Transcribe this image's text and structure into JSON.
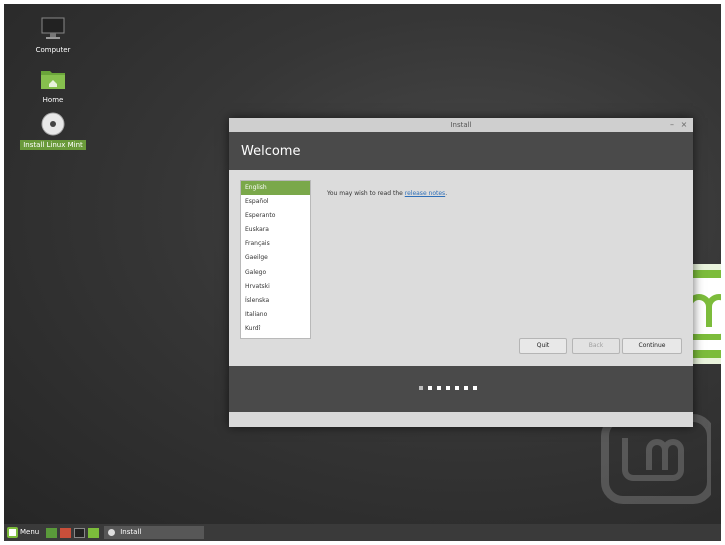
{
  "desktop": {
    "icons": [
      {
        "label": "Computer",
        "icon": "monitor-icon"
      },
      {
        "label": "Home",
        "icon": "folder-icon"
      },
      {
        "label": "Install Linux Mint",
        "icon": "disc-icon"
      }
    ]
  },
  "window": {
    "title": "Install",
    "minimize": "–",
    "close": "×",
    "heading": "Welcome",
    "languages": [
      "English",
      "Español",
      "Esperanto",
      "Euskara",
      "Français",
      "Gaeilge",
      "Galego",
      "Hrvatski",
      "Íslenska",
      "Italiano",
      "Kurdî"
    ],
    "selected_language": "English",
    "release_prefix": "You may wish to read the ",
    "release_link": "release notes",
    "release_suffix": ".",
    "buttons": {
      "quit": "Quit",
      "back": "Back",
      "continue": "Continue"
    },
    "progress": {
      "total_steps": 7,
      "current_step": 1
    }
  },
  "taskbar": {
    "menu_label": "Menu",
    "task_label": "Install"
  },
  "colors": {
    "accent": "#7aa84a",
    "header": "#4a4a4a",
    "link": "#2e6fb8"
  }
}
